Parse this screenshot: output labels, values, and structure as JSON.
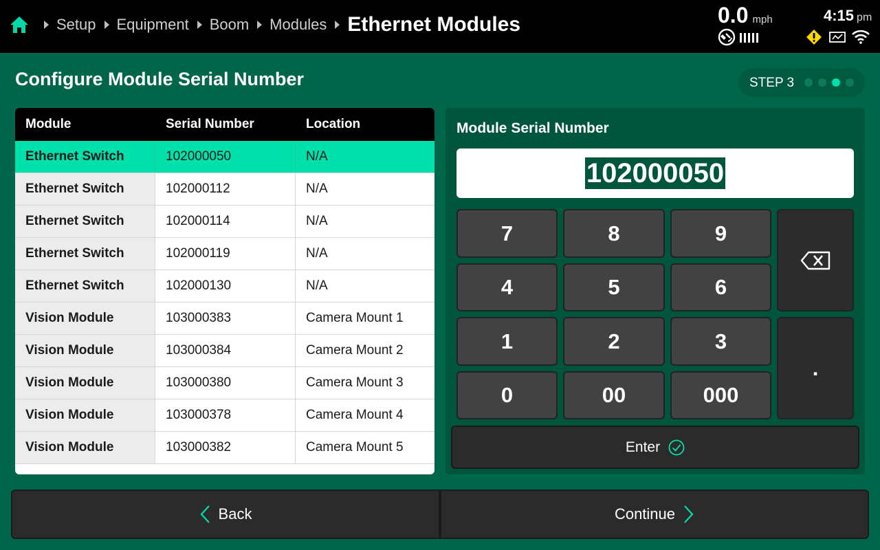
{
  "breadcrumb": {
    "items": [
      "Setup",
      "Equipment",
      "Boom",
      "Modules"
    ],
    "current": "Ethernet Modules"
  },
  "status": {
    "speed_value": "0.0",
    "speed_unit": "mph",
    "time": "4:15",
    "ampm": "pm"
  },
  "page": {
    "title": "Configure Module Serial Number",
    "step_label": "STEP 3",
    "step_count": 4,
    "step_active": 3
  },
  "table": {
    "headers": [
      "Module",
      "Serial Number",
      "Location"
    ],
    "rows": [
      {
        "module": "Ethernet Switch",
        "serial": "102000050",
        "location": "N/A"
      },
      {
        "module": "Ethernet Switch",
        "serial": "102000112",
        "location": "N/A"
      },
      {
        "module": "Ethernet Switch",
        "serial": "102000114",
        "location": "N/A"
      },
      {
        "module": "Ethernet Switch",
        "serial": "102000119",
        "location": "N/A"
      },
      {
        "module": "Ethernet Switch",
        "serial": "102000130",
        "location": "N/A"
      },
      {
        "module": "Vision Module",
        "serial": "103000383",
        "location": "Camera Mount 1"
      },
      {
        "module": "Vision Module",
        "serial": "103000384",
        "location": "Camera Mount 2"
      },
      {
        "module": "Vision Module",
        "serial": "103000380",
        "location": "Camera Mount 3"
      },
      {
        "module": "Vision Module",
        "serial": "103000378",
        "location": "Camera Mount 4"
      },
      {
        "module": "Vision Module",
        "serial": "103000382",
        "location": "Camera Mount 5"
      }
    ],
    "selected_index": 0
  },
  "keypad": {
    "title": "Module Serial Number",
    "value": "102000050",
    "keys": [
      "7",
      "8",
      "9",
      "4",
      "5",
      "6",
      "1",
      "2",
      "3",
      "0",
      "00",
      "000"
    ],
    "decimal": ".",
    "enter_label": "Enter"
  },
  "nav": {
    "back_label": "Back",
    "continue_label": "Continue"
  },
  "colors": {
    "background": "#00664a",
    "accent": "#00e0ab",
    "panel": "#00553d",
    "key": "#424242",
    "warning": "#ffd800"
  }
}
